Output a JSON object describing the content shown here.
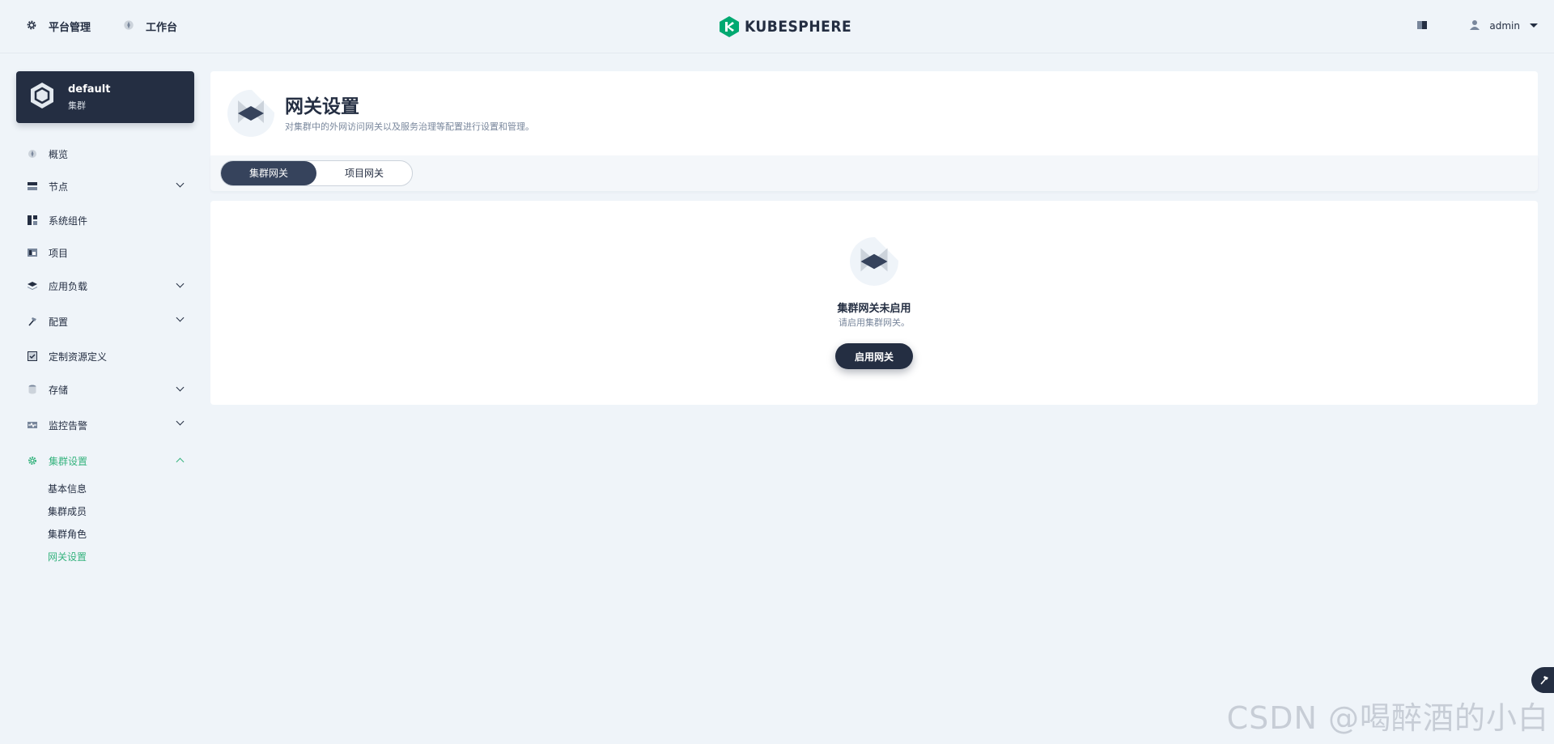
{
  "header": {
    "nav": [
      {
        "label": "平台管理",
        "icon": "gear-icon"
      },
      {
        "label": "工作台",
        "icon": "compass-icon"
      }
    ],
    "logo_text": "KUBESPHERE",
    "user": "admin"
  },
  "sidebar": {
    "cluster": {
      "name": "default",
      "sub": "集群"
    },
    "items": [
      {
        "label": "概览",
        "icon": "compass-icon"
      },
      {
        "label": "节点",
        "icon": "server-icon"
      },
      {
        "label": "系统组件",
        "icon": "components-icon"
      },
      {
        "label": "项目",
        "icon": "project-icon"
      },
      {
        "label": "应用负载",
        "icon": "layers-icon"
      },
      {
        "label": "配置",
        "icon": "hammer-icon"
      },
      {
        "label": "定制资源定义",
        "icon": "crd-icon"
      },
      {
        "label": "存储",
        "icon": "database-icon"
      },
      {
        "label": "监控告警",
        "icon": "monitor-icon"
      },
      {
        "label": "集群设置",
        "icon": "gear-icon"
      }
    ],
    "sub_items": [
      "基本信息",
      "集群成员",
      "集群角色",
      "网关设置"
    ]
  },
  "page": {
    "title": "网关设置",
    "description": "对集群中的外网访问网关以及服务治理等配置进行设置和管理。",
    "tabs": [
      "集群网关",
      "项目网关"
    ]
  },
  "empty_state": {
    "title": "集群网关未启用",
    "description": "请启用集群网关。",
    "button": "启用网关"
  },
  "watermark": "CSDN @喝醉酒的小白",
  "colors": {
    "accent": "#36b37e",
    "dark": "#242e42",
    "background": "#eff4f9"
  }
}
